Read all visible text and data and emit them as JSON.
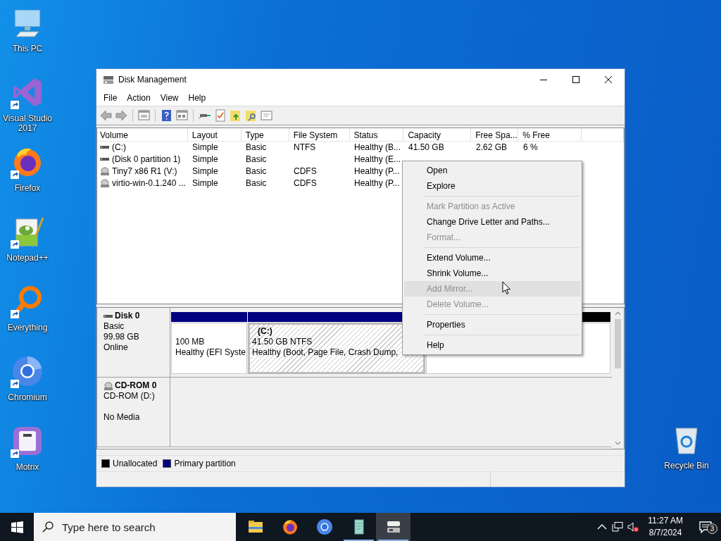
{
  "desktop_icons": [
    {
      "label": "This PC",
      "kind": "pc",
      "shortcut": false
    },
    {
      "label": "Visual Studio 2017",
      "kind": "vs",
      "shortcut": true
    },
    {
      "label": "Firefox",
      "kind": "firefox",
      "shortcut": true
    },
    {
      "label": "Notepad++",
      "kind": "notepad",
      "shortcut": true
    },
    {
      "label": "Everything",
      "kind": "everything",
      "shortcut": true
    },
    {
      "label": "Chromium",
      "kind": "chromium",
      "shortcut": true
    },
    {
      "label": "Motrix",
      "kind": "motrix",
      "shortcut": true
    }
  ],
  "recycle_bin": {
    "label": "Recycle Bin"
  },
  "window": {
    "title": "Disk Management",
    "menu": [
      "File",
      "Action",
      "View",
      "Help"
    ],
    "volume_table": {
      "columns": [
        "Volume",
        "Layout",
        "Type",
        "File System",
        "Status",
        "Capacity",
        "Free Spa...",
        "% Free"
      ],
      "rows": [
        {
          "kind": "disk",
          "volume": "(C:)",
          "layout": "Simple",
          "type": "Basic",
          "file_system": "NTFS",
          "status": "Healthy (B...",
          "capacity": "41.50 GB",
          "free_space": "2.62 GB",
          "percent_free": "6 %"
        },
        {
          "kind": "disk",
          "volume": "(Disk 0 partition 1)",
          "layout": "Simple",
          "type": "Basic",
          "status": "Healthy (E..."
        },
        {
          "kind": "cd",
          "volume": "Tiny7 x86 R1 (V:)",
          "layout": "Simple",
          "type": "Basic",
          "file_system": "CDFS",
          "status": "Healthy (P..."
        },
        {
          "kind": "cd",
          "volume": "virtio-win-0.1.240 ...",
          "layout": "Simple",
          "type": "Basic",
          "file_system": "CDFS",
          "status": "Healthy (P..."
        }
      ]
    },
    "disks": [
      {
        "name": "Disk 0",
        "kind": "disk",
        "details": [
          "Basic",
          "99.98 GB"
        ],
        "status": "Online",
        "partitions": [
          {
            "kind": "primary",
            "selected": false,
            "lines": [
              "100 MB",
              "Healthy (EFI Syste"
            ]
          },
          {
            "kind": "primary",
            "selected": true,
            "title": "(C:)",
            "lines": [
              "41.50 GB NTFS",
              "Healthy (Boot, Page File, Crash Dump,"
            ]
          },
          {
            "kind": "unallocated",
            "selected": false
          }
        ]
      },
      {
        "name": "CD-ROM 0",
        "kind": "cd",
        "details": [
          "CD-ROM (D:)"
        ],
        "status": "No Media"
      }
    ],
    "legend": [
      {
        "label": "Unallocated",
        "color": "#000000"
      },
      {
        "label": "Primary partition",
        "color": "#000080"
      }
    ]
  },
  "context_menu": {
    "items": [
      {
        "kind": "item",
        "label": "Open",
        "disabled": false,
        "selected": false
      },
      {
        "kind": "item",
        "label": "Explore",
        "disabled": false,
        "selected": false
      },
      {
        "kind": "separator"
      },
      {
        "kind": "item",
        "label": "Mark Partition as Active",
        "disabled": true,
        "selected": false
      },
      {
        "kind": "item",
        "label": "Change Drive Letter and Paths...",
        "disabled": false,
        "selected": false
      },
      {
        "kind": "item",
        "label": "Format...",
        "disabled": true,
        "selected": false
      },
      {
        "kind": "separator"
      },
      {
        "kind": "item",
        "label": "Extend Volume...",
        "disabled": false,
        "selected": false
      },
      {
        "kind": "item",
        "label": "Shrink Volume...",
        "disabled": false,
        "selected": false
      },
      {
        "kind": "item",
        "label": "Add Mirror...",
        "disabled": true,
        "selected": true
      },
      {
        "kind": "item",
        "label": "Delete Volume...",
        "disabled": true,
        "selected": false
      },
      {
        "kind": "separator"
      },
      {
        "kind": "item",
        "label": "Properties",
        "disabled": false,
        "selected": false
      },
      {
        "kind": "separator"
      },
      {
        "kind": "item",
        "label": "Help",
        "disabled": false,
        "selected": false
      }
    ]
  },
  "taskbar": {
    "search": {
      "placeholder": "Type here to search"
    },
    "apps": [
      {
        "kind": "explorer",
        "running": false,
        "selected": false
      },
      {
        "kind": "firefox",
        "running": false,
        "selected": false
      },
      {
        "kind": "chromium",
        "running": false,
        "selected": false
      },
      {
        "kind": "notepad",
        "running": true,
        "selected": false
      },
      {
        "kind": "diskmgmt",
        "running": true,
        "selected": true
      }
    ],
    "clock": {
      "time": "11:27 AM",
      "date": "8/7/2024"
    },
    "notifications": "3"
  }
}
